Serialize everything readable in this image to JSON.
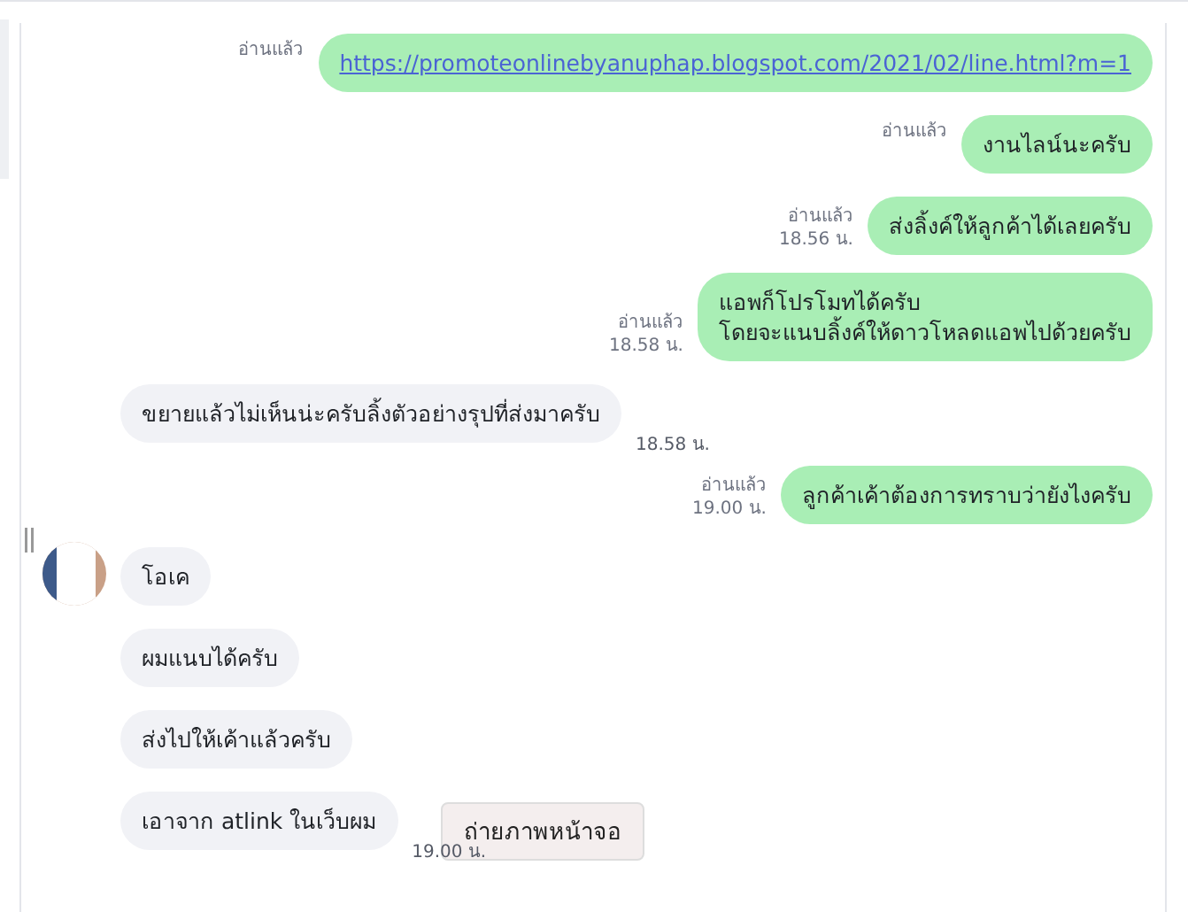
{
  "messages": [
    {
      "kind": "sent",
      "text": "https://promoteonlinebyanuphap.blogspot.com/2021/02/line.html?m=1",
      "link": true,
      "read": "อ่านแล้ว"
    },
    {
      "kind": "sent",
      "text": "งานไลน์นะครับ",
      "read": "อ่านแล้ว"
    },
    {
      "kind": "sent",
      "text": "ส่งลิ้งค์ให้ลูกค้าได้เลยครับ",
      "read": "อ่านแล้ว",
      "time": "18.56 น."
    },
    {
      "kind": "sent",
      "lines": [
        "แอพก็โปรโมทได้ครับ",
        "โดยจะแนบลิ้งค์ให้ดาวโหลดแอพไปด้วยครับ"
      ],
      "read": "อ่านแล้ว",
      "time": "18.58 น."
    },
    {
      "kind": "received",
      "text": "ขยายแล้วไม่เห็นน่ะครับลิ้งตัวอย่างรุปที่ส่งมาครับ",
      "time": "18.58 น."
    },
    {
      "kind": "sent",
      "text": "ลูกค้าเค้าต้องการทราบว่ายังไงครับ",
      "read": "อ่านแล้ว",
      "time": "19.00 น."
    },
    {
      "kind": "received",
      "text": "โอเค",
      "avatar": true
    },
    {
      "kind": "received",
      "text": "ผมแนบได้ครับ"
    },
    {
      "kind": "received",
      "text": "ส่งไปให้เค้าแล้วครับ"
    },
    {
      "kind": "received",
      "text": "เอาจาก atlink ในเว็บผม",
      "time": "19.00 น."
    }
  ],
  "tooltip": {
    "text": "ถ่ายภาพหน้าจอ"
  }
}
